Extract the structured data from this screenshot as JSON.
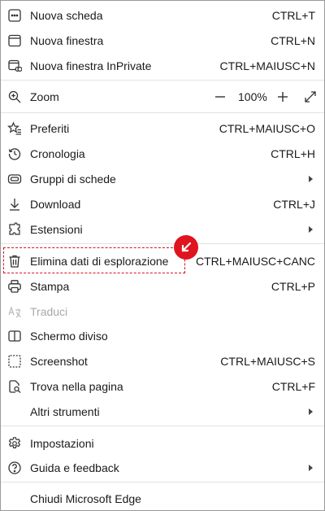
{
  "menu": {
    "new_tab": {
      "icon": "new-tab-icon",
      "label": "Nuova scheda",
      "shortcut": "CTRL+T"
    },
    "new_window": {
      "icon": "new-window-icon",
      "label": "Nuova finestra",
      "shortcut": "CTRL+N"
    },
    "new_inprivate": {
      "icon": "inprivate-window-icon",
      "label": "Nuova finestra InPrivate",
      "shortcut": "CTRL+MAIUSC+N"
    },
    "zoom": {
      "icon": "zoom-icon",
      "label": "Zoom",
      "value": "100%"
    },
    "favorites": {
      "icon": "favorites-icon",
      "label": "Preferiti",
      "shortcut": "CTRL+MAIUSC+O"
    },
    "history": {
      "icon": "history-icon",
      "label": "Cronologia",
      "shortcut": "CTRL+H"
    },
    "tab_groups": {
      "icon": "tab-groups-icon",
      "label": "Gruppi di schede"
    },
    "downloads": {
      "icon": "download-icon",
      "label": "Download",
      "shortcut": "CTRL+J"
    },
    "extensions": {
      "icon": "extensions-icon",
      "label": "Estensioni"
    },
    "clear_data": {
      "icon": "trash-icon",
      "label": "Elimina dati di esplorazione",
      "shortcut": "CTRL+MAIUSC+CANC"
    },
    "print": {
      "icon": "print-icon",
      "label": "Stampa",
      "shortcut": "CTRL+P"
    },
    "translate": {
      "icon": "translate-icon",
      "label": "Traduci"
    },
    "split_screen": {
      "icon": "split-screen-icon",
      "label": "Schermo diviso"
    },
    "screenshot": {
      "icon": "screenshot-icon",
      "label": "Screenshot",
      "shortcut": "CTRL+MAIUSC+S"
    },
    "find": {
      "icon": "find-on-page-icon",
      "label": "Trova nella pagina",
      "shortcut": "CTRL+F"
    },
    "more_tools": {
      "label": "Altri strumenti"
    },
    "settings": {
      "icon": "settings-icon",
      "label": "Impostazioni"
    },
    "help": {
      "icon": "help-icon",
      "label": "Guida e feedback"
    },
    "close": {
      "label": "Chiudi Microsoft Edge"
    }
  },
  "colors": {
    "highlight": "#d8141f",
    "badge": "#e0141f",
    "separator": "#e3e3e3",
    "disabled_text": "#a8a8a8"
  }
}
